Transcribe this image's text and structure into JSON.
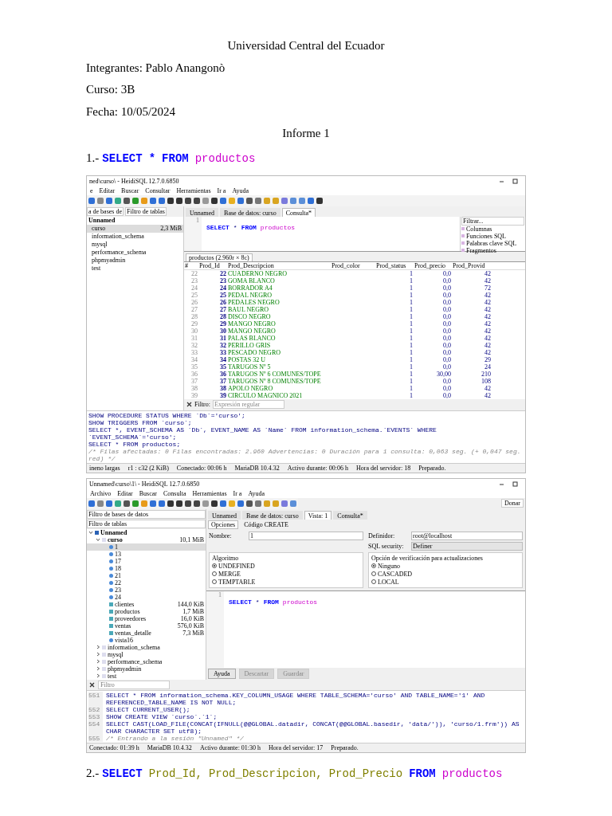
{
  "document": {
    "title": "Universidad Central del Ecuador",
    "lines": [
      "Integrantes: Pablo Anangonò",
      "Curso: 3B",
      "Fecha: 10/05/2024"
    ],
    "heading": "Informe 1"
  },
  "query_1": {
    "number": "1.-",
    "tokens": [
      {
        "kind": "keyword",
        "text": "SELECT"
      },
      {
        "kind": "keyword",
        "text": "*"
      },
      {
        "kind": "keyword",
        "text": "FROM"
      },
      {
        "kind": "table",
        "text": "productos"
      }
    ]
  },
  "window_1": {
    "title": "ned\\curso\\ - HeidiSQL 12.7.0.6850",
    "menu": [
      "e",
      "Editar",
      "Buscar",
      "Consultar",
      "Herramientas",
      "Ir a",
      "Ayuda"
    ],
    "db_filter": "a de bases de",
    "table_filter": "Filtro de tablas",
    "tabs": [
      {
        "label": "Unnamed",
        "selected": false
      },
      {
        "label": "Base de datos: curso",
        "selected": false
      },
      {
        "label": "Consulta*",
        "selected": true
      }
    ],
    "tree": [
      {
        "label": "Unnamed",
        "selected": false
      },
      {
        "label": "curso",
        "size": "2,3 MiB",
        "selected": true
      },
      {
        "label": "information_schema",
        "selected": false
      },
      {
        "label": "mysql",
        "selected": false
      },
      {
        "label": "performance_schema",
        "selected": false
      },
      {
        "label": "phpmyadmin",
        "selected": false
      },
      {
        "label": "test",
        "selected": false
      }
    ],
    "editor": {
      "line": "1",
      "tokens": [
        {
          "kind": "keyword",
          "text": "SELECT"
        },
        {
          "kind": "plain",
          "text": "*"
        },
        {
          "kind": "keyword",
          "text": "FROM"
        },
        {
          "kind": "table",
          "text": "productos"
        }
      ]
    },
    "helpers": {
      "filter": "Filtrar...",
      "items": [
        "Columnas",
        "Funciones SQL",
        "Palabras clave SQL",
        "Fragmentos"
      ]
    },
    "result_tab": "productos (2.960r × 8c)",
    "columns": [
      "#",
      "Prod_Id",
      "Prod_Descripcion",
      "Prod_color",
      "Prod_status",
      "Prod_precio",
      "Prod_Provid"
    ],
    "rows": [
      [
        "22",
        "22",
        "CUADERNO NEGRO",
        "",
        "1",
        "0,0",
        "42"
      ],
      [
        "23",
        "23",
        "GOMA BLANCO",
        "",
        "1",
        "0,0",
        "42"
      ],
      [
        "24",
        "24",
        "BORRADOR A4",
        "",
        "1",
        "0,0",
        "72"
      ],
      [
        "25",
        "25",
        "PEDAL NEGRO",
        "",
        "1",
        "0,0",
        "42"
      ],
      [
        "26",
        "26",
        "PEDALES NEGRO",
        "",
        "1",
        "0,0",
        "42"
      ],
      [
        "27",
        "27",
        "BAUL NEGRO",
        "",
        "1",
        "0,0",
        "42"
      ],
      [
        "28",
        "28",
        "DISCO NEGRO",
        "",
        "1",
        "0,0",
        "42"
      ],
      [
        "29",
        "29",
        "MANGO NEGRO",
        "",
        "1",
        "0,0",
        "42"
      ],
      [
        "30",
        "30",
        "MANGO NEGRO",
        "",
        "1",
        "0,0",
        "42"
      ],
      [
        "31",
        "31",
        "PALAS BLANCO",
        "",
        "1",
        "0,0",
        "42"
      ],
      [
        "32",
        "32",
        "PERILLO GRIS",
        "",
        "1",
        "0,0",
        "42"
      ],
      [
        "33",
        "33",
        "PESCADO NEGRO",
        "",
        "1",
        "0,0",
        "42"
      ],
      [
        "34",
        "34",
        "POSTAS 32 U",
        "",
        "1",
        "0,0",
        "29"
      ],
      [
        "35",
        "35",
        "TARUGOS Nº 5",
        "",
        "1",
        "0,0",
        "24"
      ],
      [
        "36",
        "36",
        "TARUGOS Nº 6 COMUNES/TOPE",
        "",
        "1",
        "30,00",
        "210"
      ],
      [
        "37",
        "37",
        "TARUGOS Nº 8 COMUNES/TOPE",
        "",
        "1",
        "0,0",
        "108"
      ],
      [
        "38",
        "38",
        "APOLO NEGRO",
        "",
        "1",
        "0,0",
        "42"
      ],
      [
        "39",
        "39",
        "CIRCULO MAGNICO 2021",
        "",
        "1",
        "0,0",
        "42"
      ]
    ],
    "filter_label": "Filtro:",
    "filter_placeholder": "Expresión regular",
    "log": [
      {
        "kind": "sql",
        "text": "SHOW PROCEDURE STATUS WHERE `Db`='curso';"
      },
      {
        "kind": "sql",
        "text": "SHOW TRIGGERS FROM `curso`;"
      },
      {
        "kind": "sql",
        "text": "SELECT *, EVENT_SCHEMA AS `Db`, EVENT_NAME AS `Name` FROM information_schema.`EVENTS` WHERE `EVENT_SCHEMA`='curso';"
      },
      {
        "kind": "sql",
        "text": "SELECT * FROM productos;"
      },
      {
        "kind": "comment",
        "text": "/* Filas afectadas: 0  Filas encontradas: 2.960  Advertencias: 0  Duración para 1 consulta: 0,063 seg. (+ 0,047 seg. red) */"
      }
    ],
    "status": [
      "ineno largas",
      "r1 : c32 (2 KiB)",
      "Conectado: 00:06 h",
      "MariaDB 10.4.32",
      "Activo durante: 00:06 h",
      "Hora del servidor: 18",
      "Preparado."
    ]
  },
  "window_2": {
    "title": "Unnamed\\curso\\1\\ - HeidiSQL 12.7.0.6850",
    "menu": [
      "Archivo",
      "Editar",
      "Buscar",
      "Consulta",
      "Herramientas",
      "Ir a",
      "Ayuda"
    ],
    "donate": "Donar",
    "db_filter": "Filtro de bases de datos",
    "table_filter": "Filtro de tablas",
    "tabs": [
      {
        "label": "Unnamed",
        "selected": false
      },
      {
        "label": "Base de datos: curso",
        "selected": false
      },
      {
        "label": "Vista: 1",
        "selected": true
      },
      {
        "label": "Consulta*",
        "selected": false
      }
    ],
    "subtabs": [
      {
        "label": "Opciones",
        "selected": true
      },
      {
        "label": "Código CREATE",
        "selected": false
      }
    ],
    "tree": [
      {
        "label": "Unnamed",
        "kind": "server",
        "expanded": true,
        "selected": false,
        "children": [
          {
            "label": "curso",
            "kind": "database",
            "size": "10,1 MiB",
            "expanded": true,
            "selected": false,
            "children": [
              {
                "label": "1",
                "kind": "view",
                "selected": true
              },
              {
                "label": "13",
                "kind": "view",
                "selected": false
              },
              {
                "label": "17",
                "kind": "view",
                "selected": false
              },
              {
                "label": "18",
                "kind": "view",
                "selected": false
              },
              {
                "label": "21",
                "kind": "view",
                "selected": false
              },
              {
                "label": "22",
                "kind": "view",
                "selected": false
              },
              {
                "label": "23",
                "kind": "view",
                "selected": false
              },
              {
                "label": "24",
                "kind": "view",
                "selected": false
              },
              {
                "label": "clientes",
                "kind": "table",
                "size": "144,0 KiB",
                "selected": false
              },
              {
                "label": "productos",
                "kind": "table",
                "size": "1,7 MiB",
                "selected": false
              },
              {
                "label": "proveedores",
                "kind": "table",
                "size": "16,0 KiB",
                "selected": false
              },
              {
                "label": "ventas",
                "kind": "table",
                "size": "576,0 KiB",
                "selected": false
              },
              {
                "label": "ventas_detalle",
                "kind": "table",
                "size": "7,3 MiB",
                "selected": false
              },
              {
                "label": "vista16",
                "kind": "view",
                "selected": false
              }
            ]
          },
          {
            "label": "information_schema",
            "kind": "database",
            "expanded": false,
            "selected": false
          },
          {
            "label": "mysql",
            "kind": "database",
            "expanded": false,
            "selected": false
          },
          {
            "label": "performance_schema",
            "kind": "database",
            "expanded": false,
            "selected": false
          },
          {
            "label": "phpmyadmin",
            "kind": "database",
            "expanded": false,
            "selected": false
          },
          {
            "label": "test",
            "kind": "database",
            "expanded": false,
            "selected": false
          }
        ]
      }
    ],
    "name_label": "Nombre:",
    "name_value": "1",
    "definer_label": "Definidor:",
    "definer_value": "root@localhost",
    "security_label": "SQL security:",
    "security_value": "Definer",
    "algorithm": {
      "title": "Algoritmo",
      "options": [
        {
          "label": "UNDEFINED",
          "selected": true
        },
        {
          "label": "MERGE",
          "selected": false
        },
        {
          "label": "TEMPTABLE",
          "selected": false
        }
      ]
    },
    "check": {
      "title": "Opción de verificación para actualizaciones",
      "options": [
        {
          "label": "Ninguno",
          "selected": true
        },
        {
          "label": "CASCADED",
          "selected": false
        },
        {
          "label": "LOCAL",
          "selected": false
        }
      ]
    },
    "editor": {
      "line": "1",
      "tokens": [
        {
          "kind": "keyword",
          "text": "SELECT"
        },
        {
          "kind": "plain",
          "text": "*"
        },
        {
          "kind": "keyword",
          "text": "FROM"
        },
        {
          "kind": "table",
          "text": "productos"
        }
      ]
    },
    "buttons": [
      {
        "label": "Ayuda",
        "disabled": false
      },
      {
        "label": "Descartar",
        "disabled": true
      },
      {
        "label": "Guardar",
        "disabled": true
      }
    ],
    "filter_label": "Filtro",
    "log": [
      {
        "num": "551",
        "kind": "sql",
        "text": "SELECT * FROM information_schema.KEY_COLUMN_USAGE WHERE   TABLE_SCHEMA='curso'   AND TABLE_NAME='1'   AND REFERENCED_TABLE_NAME IS NOT NULL;"
      },
      {
        "num": "552",
        "kind": "sql",
        "text": "SELECT CURRENT_USER();"
      },
      {
        "num": "553",
        "kind": "sql",
        "text": "SHOW CREATE VIEW `curso`.`1`;"
      },
      {
        "num": "554",
        "kind": "sql",
        "text": "SELECT CAST(LOAD_FILE(CONCAT(IFNULL(@@GLOBAL.datadir, CONCAT(@@GLOBAL.basedir, 'data/')), 'curso/1.frm')) AS CHAR CHARACTER SET utf8);"
      },
      {
        "num": "555",
        "kind": "comment",
        "text": "/* Entrando a la sesión \"Unnamed\" */"
      }
    ],
    "status": [
      "Conectado: 01:39 h",
      "MariaDB 10.4.32",
      "Activo durante: 01:30 h",
      "Hora del servidor: 17",
      "Preparado."
    ]
  },
  "query_2": {
    "number": "2.-",
    "tokens": [
      {
        "kind": "keyword",
        "text": "SELECT"
      },
      {
        "kind": "column",
        "text": "Prod_Id,"
      },
      {
        "kind": "column",
        "text": "Prod_Descripcion,"
      },
      {
        "kind": "column",
        "text": "Prod_Precio"
      },
      {
        "kind": "keyword",
        "text": "FROM"
      },
      {
        "kind": "table",
        "text": "productos"
      }
    ]
  }
}
